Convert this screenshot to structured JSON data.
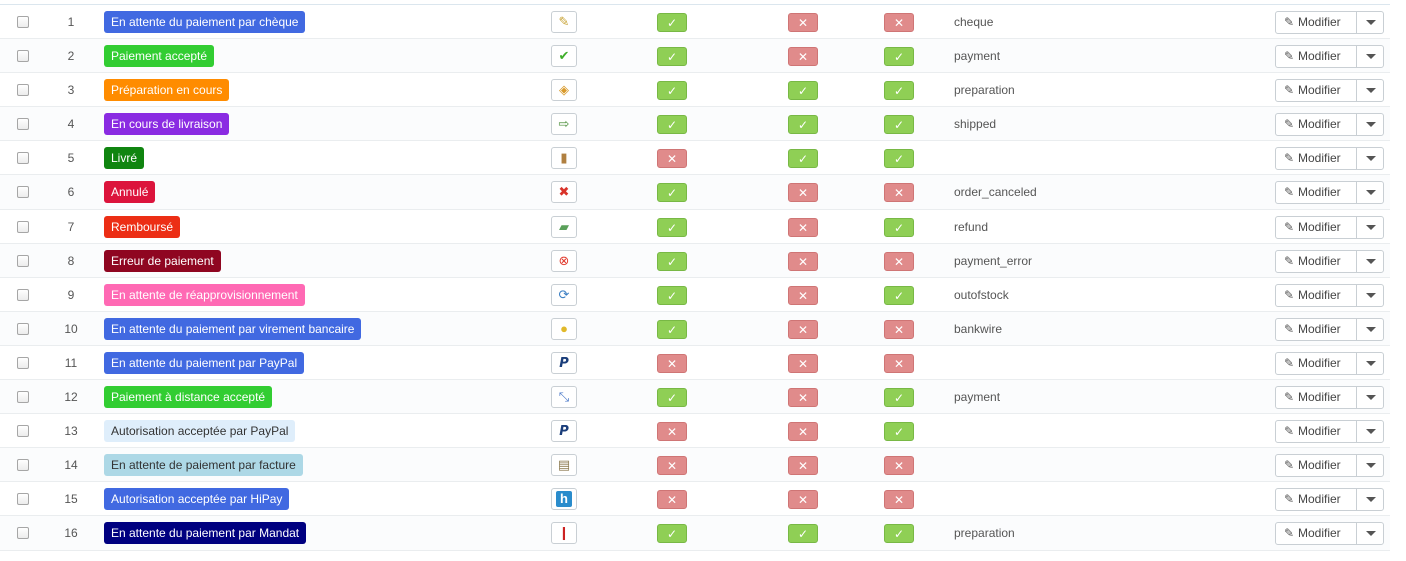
{
  "action_label": "Modifier",
  "rows": [
    {
      "id": "1",
      "status": "En attente du paiement par chèque",
      "color": "#4169e1",
      "light": false,
      "icon": "cheque-icon",
      "glyph": "✎",
      "iconclass": "ico-cheque",
      "c1": true,
      "c2": false,
      "c3": false,
      "template": "cheque"
    },
    {
      "id": "2",
      "status": "Paiement accepté",
      "color": "#32cd32",
      "light": false,
      "icon": "check-icon",
      "glyph": "✔",
      "iconclass": "ico-check",
      "c1": true,
      "c2": false,
      "c3": true,
      "template": "payment"
    },
    {
      "id": "3",
      "status": "Préparation en cours",
      "color": "#ff8c00",
      "light": false,
      "icon": "box-icon",
      "glyph": "◈",
      "iconclass": "ico-box",
      "c1": true,
      "c2": true,
      "c3": true,
      "template": "preparation"
    },
    {
      "id": "4",
      "status": "En cours de livraison",
      "color": "#8a2be2",
      "light": false,
      "icon": "truck-icon",
      "glyph": "⇨",
      "iconclass": "ico-truck",
      "c1": true,
      "c2": true,
      "c3": true,
      "template": "shipped"
    },
    {
      "id": "5",
      "status": "Livré",
      "color": "#108510",
      "light": false,
      "icon": "delivered-icon",
      "glyph": "▮",
      "iconclass": "ico-door",
      "c1": false,
      "c2": true,
      "c3": true,
      "template": ""
    },
    {
      "id": "6",
      "status": "Annulé",
      "color": "#dc143c",
      "light": false,
      "icon": "cancel-icon",
      "glyph": "✖",
      "iconclass": "ico-x",
      "c1": true,
      "c2": false,
      "c3": false,
      "template": "order_canceled"
    },
    {
      "id": "7",
      "status": "Remboursé",
      "color": "#ec2e15",
      "light": false,
      "icon": "money-icon",
      "glyph": "▰",
      "iconclass": "ico-money",
      "c1": true,
      "c2": false,
      "c3": true,
      "template": "refund"
    },
    {
      "id": "8",
      "status": "Erreur de paiement",
      "color": "#8f0621",
      "light": false,
      "icon": "error-icon",
      "glyph": "⊗",
      "iconclass": "ico-err",
      "c1": true,
      "c2": false,
      "c3": false,
      "template": "payment_error"
    },
    {
      "id": "9",
      "status": "En attente de réapprovisionnement",
      "color": "#ff69b4",
      "light": false,
      "icon": "restock-icon",
      "glyph": "⟳",
      "iconclass": "ico-refresh",
      "c1": true,
      "c2": false,
      "c3": true,
      "template": "outofstock"
    },
    {
      "id": "10",
      "status": "En attente du paiement par virement bancaire",
      "color": "#4169e1",
      "light": false,
      "icon": "coins-icon",
      "glyph": "●",
      "iconclass": "ico-coins",
      "c1": true,
      "c2": false,
      "c3": false,
      "template": "bankwire"
    },
    {
      "id": "11",
      "status": "En attente du paiement par PayPal",
      "color": "#4169e1",
      "light": false,
      "icon": "paypal-icon",
      "glyph": "P",
      "iconclass": "ico-pp",
      "c1": false,
      "c2": false,
      "c3": false,
      "template": ""
    },
    {
      "id": "12",
      "status": "Paiement à distance accepté",
      "color": "#32cd32",
      "light": false,
      "icon": "remote-payment-icon",
      "glyph": "⤡",
      "iconclass": "ico-remote",
      "c1": true,
      "c2": false,
      "c3": true,
      "template": "payment"
    },
    {
      "id": "13",
      "status": "Autorisation acceptée par PayPal",
      "color": "#dfeefb",
      "light": true,
      "icon": "paypal-icon",
      "glyph": "P",
      "iconclass": "ico-pp",
      "c1": false,
      "c2": false,
      "c3": true,
      "template": ""
    },
    {
      "id": "14",
      "status": "En attente de paiement par facture",
      "color": "#add8e6",
      "light": true,
      "icon": "invoice-icon",
      "glyph": "▤",
      "iconclass": "ico-doc",
      "c1": false,
      "c2": false,
      "c3": false,
      "template": ""
    },
    {
      "id": "15",
      "status": "Autorisation acceptée par HiPay",
      "color": "#4169e1",
      "light": false,
      "icon": "hipay-icon",
      "glyph": "h",
      "iconclass": "ico-h",
      "c1": false,
      "c2": false,
      "c3": false,
      "template": ""
    },
    {
      "id": "16",
      "status": "En attente du paiement par Mandat",
      "color": "#000080",
      "light": false,
      "icon": "mandat-icon",
      "glyph": "❙",
      "iconclass": "ico-flag",
      "c1": true,
      "c2": true,
      "c3": true,
      "template": "preparation"
    }
  ]
}
